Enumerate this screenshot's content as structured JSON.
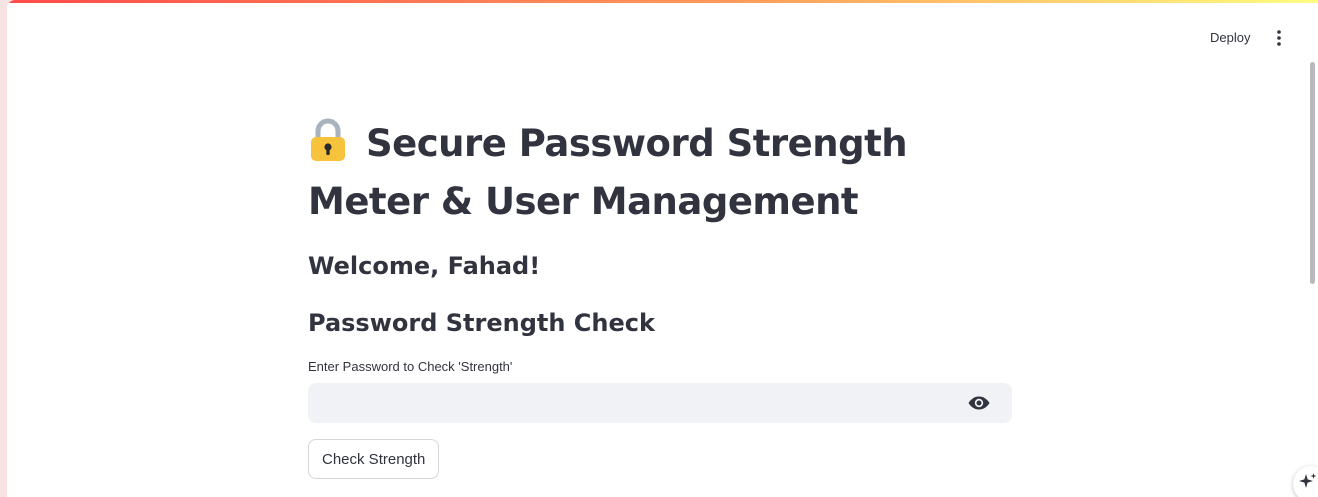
{
  "header": {
    "deploy_label": "Deploy",
    "menu_icon": "vertical-dots-icon"
  },
  "main": {
    "title_icon": "lock-icon",
    "title": "Secure Password Strength Meter & User Management",
    "welcome": "Welcome, Fahad!",
    "section_title": "Password Strength Check",
    "password_label": "Enter Password to Check 'Strength'",
    "password_value": "",
    "reveal_icon": "eye-icon",
    "check_button_label": "Check Strength"
  },
  "floating": {
    "assistant_icon": "sparkle-icon"
  },
  "colors": {
    "text": "#31333f",
    "input_background": "#f0f2f6",
    "lock_yellow": "#f7c33c",
    "decoration_start": "#ff4b4b",
    "decoration_end": "#fffd80"
  }
}
